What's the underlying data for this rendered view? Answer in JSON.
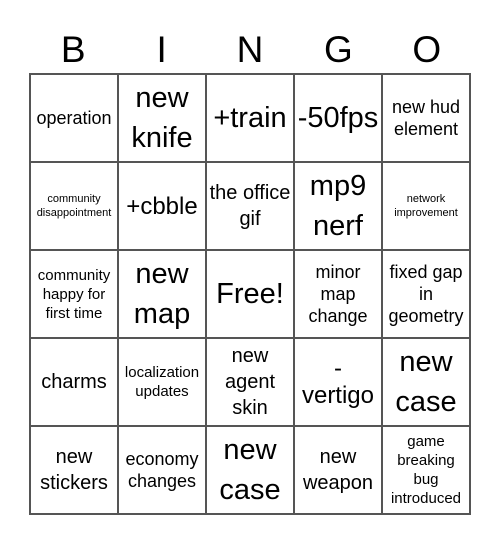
{
  "header": [
    "B",
    "I",
    "N",
    "G",
    "O"
  ],
  "cells": [
    [
      {
        "text": "operation",
        "size": "s-m"
      },
      {
        "text": "new knife",
        "size": "s-xl"
      },
      {
        "text": "+train",
        "size": "s-xl"
      },
      {
        "text": "-50fps",
        "size": "s-xl"
      },
      {
        "text": "new hud element",
        "size": "s-m"
      }
    ],
    [
      {
        "text": "community disappointment",
        "size": "s-xs"
      },
      {
        "text": "+cbble",
        "size": "s-l"
      },
      {
        "text": "the office gif",
        "size": "s-ml"
      },
      {
        "text": "mp9 nerf",
        "size": "s-xl"
      },
      {
        "text": "network improvement",
        "size": "s-xs"
      }
    ],
    [
      {
        "text": "community happy for first time",
        "size": "s-s"
      },
      {
        "text": "new map",
        "size": "s-xl"
      },
      {
        "text": "Free!",
        "size": "s-xl"
      },
      {
        "text": "minor map change",
        "size": "s-m"
      },
      {
        "text": "fixed gap in geometry",
        "size": "s-m"
      }
    ],
    [
      {
        "text": "charms",
        "size": "s-ml"
      },
      {
        "text": "localization updates",
        "size": "s-s"
      },
      {
        "text": "new agent skin",
        "size": "s-ml"
      },
      {
        "text": "- vertigo",
        "size": "s-l"
      },
      {
        "text": "new case",
        "size": "s-xl"
      }
    ],
    [
      {
        "text": "new stickers",
        "size": "s-ml"
      },
      {
        "text": "economy changes",
        "size": "s-m"
      },
      {
        "text": "new case",
        "size": "s-xl"
      },
      {
        "text": "new weapon",
        "size": "s-ml"
      },
      {
        "text": "game breaking bug introduced",
        "size": "s-s"
      }
    ]
  ]
}
